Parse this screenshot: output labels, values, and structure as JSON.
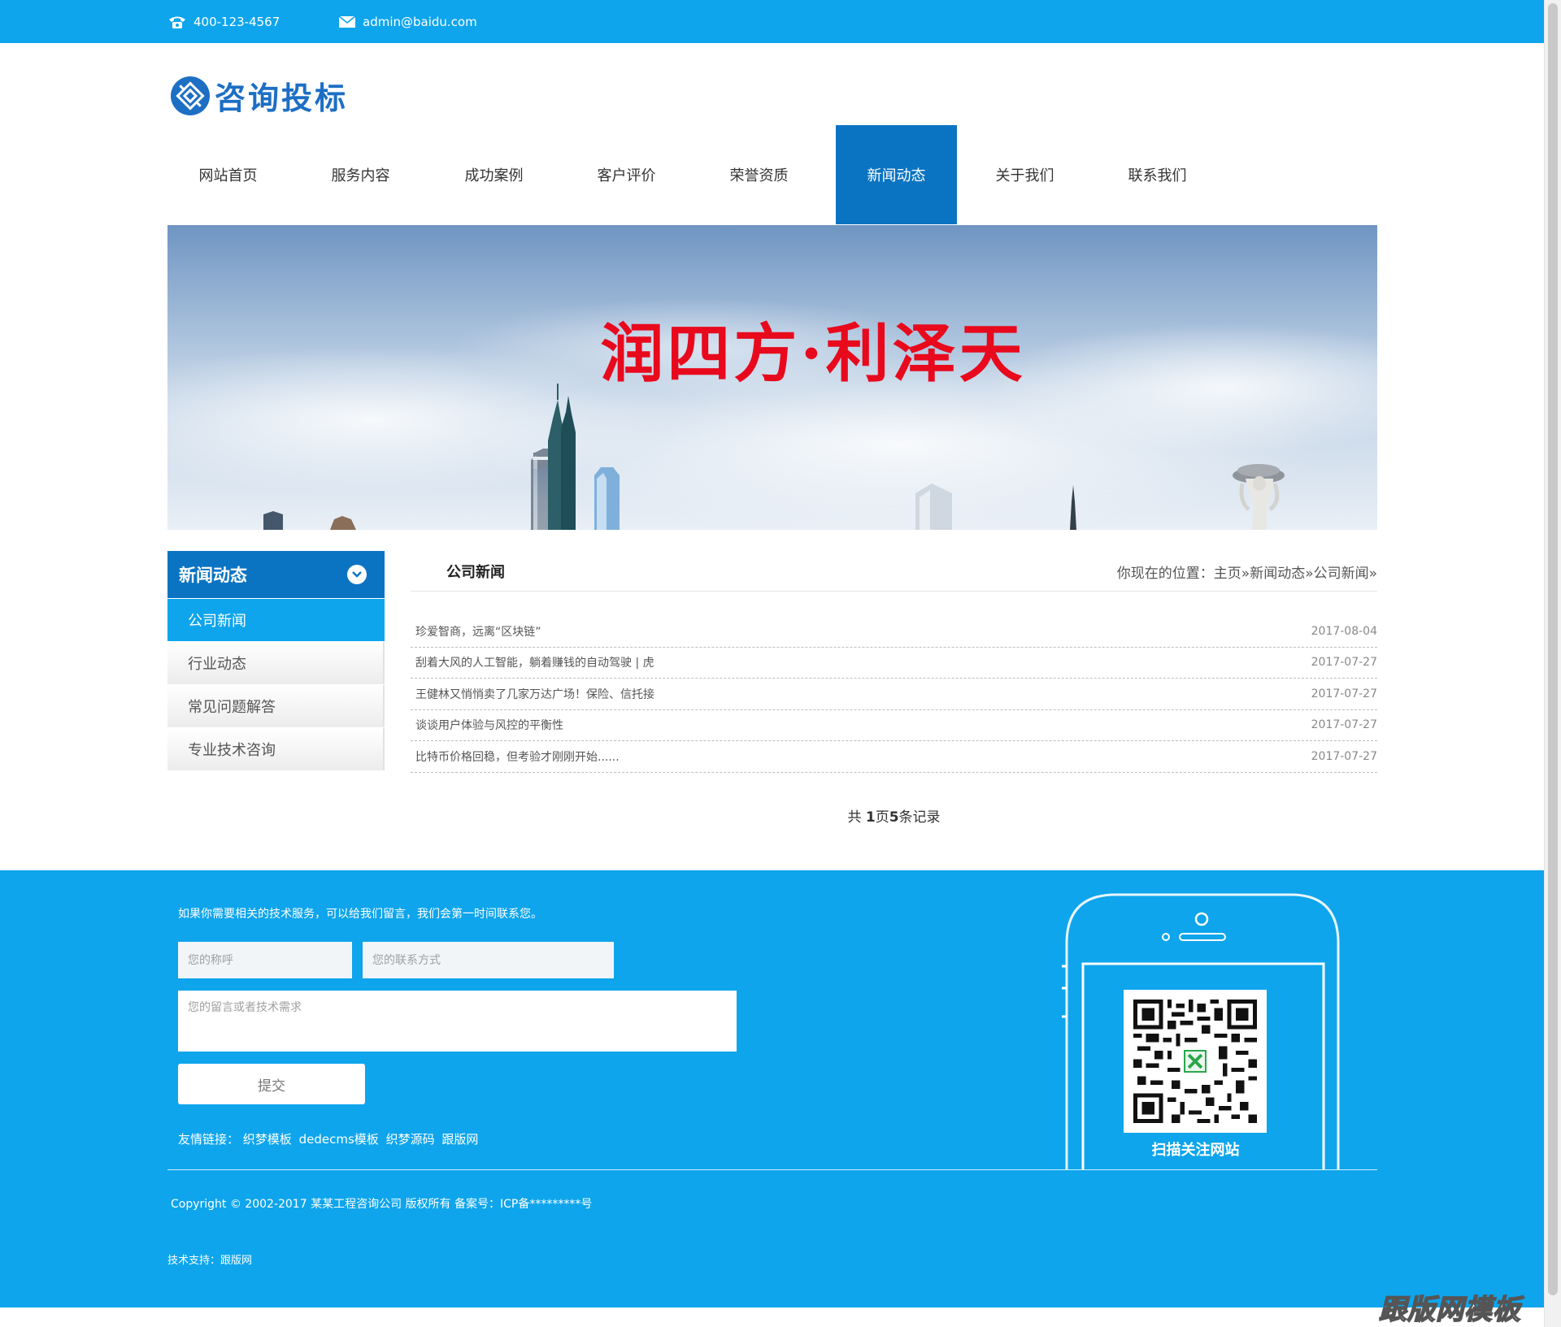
{
  "topbar": {
    "phone": "400-123-4567",
    "email": "admin@baidu.com"
  },
  "logo": {
    "text": "咨询投标"
  },
  "nav": [
    {
      "label": "网站首页",
      "active": false
    },
    {
      "label": "服务内容",
      "active": false
    },
    {
      "label": "成功案例",
      "active": false
    },
    {
      "label": "客户评价",
      "active": false
    },
    {
      "label": "荣誉资质",
      "active": false
    },
    {
      "label": "新闻动态",
      "active": true
    },
    {
      "label": "关于我们",
      "active": false
    },
    {
      "label": "联系我们",
      "active": false
    }
  ],
  "banner": {
    "slogan": "润四方·利泽天"
  },
  "sidebar": {
    "title": "新闻动态",
    "items": [
      {
        "label": "公司新闻",
        "active": true
      },
      {
        "label": "行业动态",
        "active": false
      },
      {
        "label": "常见问题解答",
        "active": false
      },
      {
        "label": "专业技术咨询",
        "active": false
      }
    ]
  },
  "content": {
    "title": "公司新闻",
    "breadcrumb": "你现在的位置：主页»新闻动态»公司新闻»",
    "news": [
      {
        "title": "珍爱智商，远离“区块链”",
        "date": "2017-08-04"
      },
      {
        "title": "刮着大风的人工智能，躺着赚钱的自动驾驶 | 虎",
        "date": "2017-07-27"
      },
      {
        "title": "王健林又悄悄卖了几家万达广场！保险、信托接",
        "date": "2017-07-27"
      },
      {
        "title": "谈谈用户体验与风控的平衡性",
        "date": "2017-07-27"
      },
      {
        "title": "比特币价格回稳，但考验才刚刚开始......",
        "date": "2017-07-27"
      }
    ],
    "pager": {
      "prefix": "共 ",
      "pages": "1",
      "middle": "页",
      "records": "5",
      "suffix": "条记录"
    }
  },
  "footer": {
    "intro": "如果你需要相关的技术服务，可以给我们留言，我们会第一时间联系您。",
    "name_placeholder": "您的称呼",
    "contact_placeholder": "您的联系方式",
    "message_placeholder": "您的留言或者技术需求",
    "submit_label": "提交",
    "links_label": "友情链接：",
    "links": [
      "织梦模板",
      "dedecms模板",
      "织梦源码",
      "跟版网"
    ],
    "copyright": "Copyright © 2002-2017 某某工程咨询公司 版权所有   备案号：ICP备*********号",
    "support": "技术支持：跟版网",
    "qr_caption": "扫描关注网站"
  },
  "watermark": "跟版网模板",
  "colors": {
    "topbar": "#0ea5ec",
    "nav_active": "#0b74c2",
    "footer": "#0ea5ec",
    "slogan": "#e8091d",
    "logo": "#1d6fc4"
  }
}
